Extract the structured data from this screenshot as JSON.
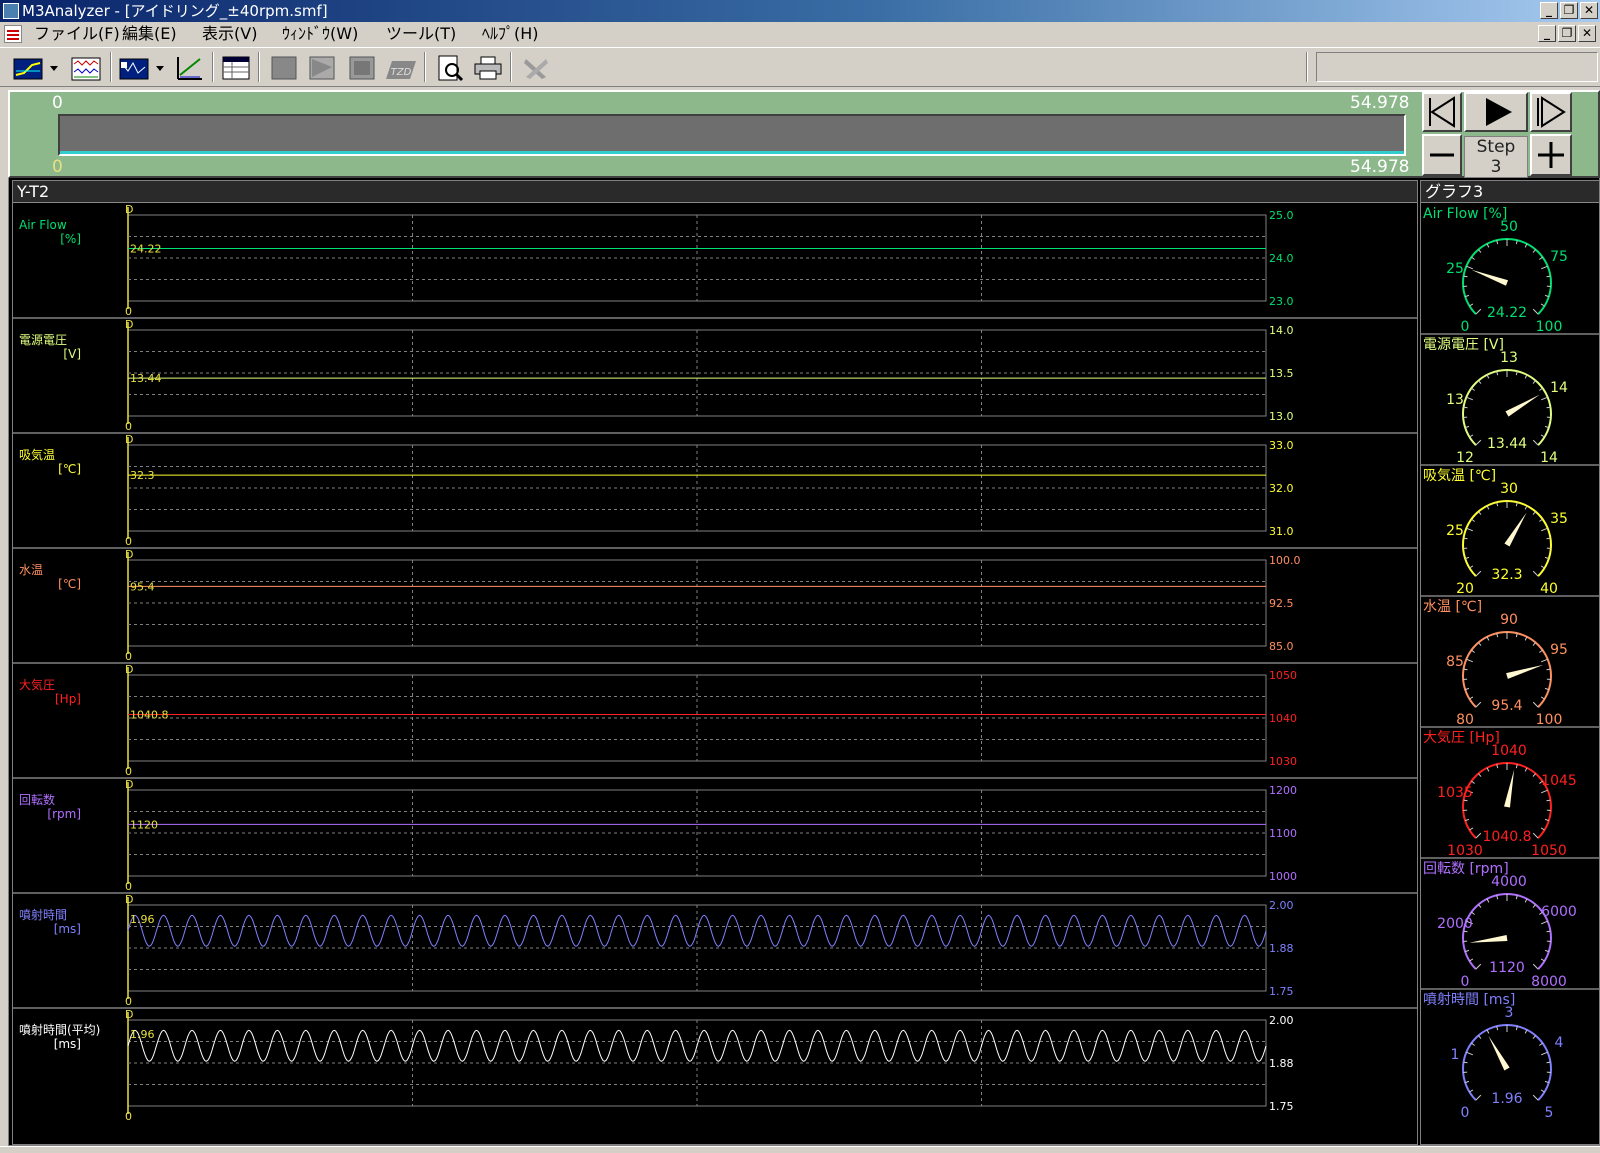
{
  "window": {
    "title": "M3Analyzer - [アイドリング_±40rpm.smf]"
  },
  "menu": [
    "ファイル(F)",
    "編集(E)",
    "表示(V)",
    "ｳｨﾝﾄﾞｳ(W)",
    "ツール(T)",
    "ﾍﾙﾌﾟ(H)"
  ],
  "toolbar": [
    "yt-graph-icon",
    "dropdown-arrow-icon",
    "waveform-list-icon",
    "signal-select-icon",
    "dropdown-arrow-icon",
    "ruler-measure-icon",
    "data-table-icon",
    "block-solid-icon",
    "block-triangle-icon",
    "block-frame-icon",
    "tzd-icon",
    "print-preview-icon",
    "print-icon",
    "disabled-tool-icon"
  ],
  "timeline": {
    "start_top": "0",
    "end_top": "54.978",
    "start_bottom": "0",
    "end_bottom": "54.978",
    "step_label": "Step",
    "step_value": "3"
  },
  "yt_panel": {
    "title": "Y-T2"
  },
  "gauge_panel": {
    "title": "グラフ3"
  },
  "channels": [
    {
      "name": "Air Flow",
      "unit": "[%]",
      "color": "#00e070",
      "value": "24.22",
      "ymax_label": "25.0",
      "ymid_label": "24.0",
      "ymin_label": "23.0",
      "ymin": 23.0,
      "ymax": 25.0,
      "level": 24.22,
      "wave": false,
      "gauge": {
        "title": "Air Flow [%]",
        "min": 0,
        "max": 100,
        "value": 24.22,
        "value_label": "24.22",
        "ticks": [
          "0",
          "25",
          "50",
          "75",
          "100"
        ]
      }
    },
    {
      "name": "電源電圧",
      "unit": "[V]",
      "color": "#e0ff80",
      "value": "13.44",
      "ymax_label": "14.0",
      "ymid_label": "13.5",
      "ymin_label": "13.0",
      "ymin": 13.0,
      "ymax": 14.0,
      "level": 13.44,
      "wave": false,
      "gauge": {
        "title": "電源電圧 [V]",
        "min": 12,
        "max": 14,
        "value": 13.44,
        "value_label": "13.44",
        "ticks": [
          "12",
          "13",
          "13",
          "14",
          "14"
        ]
      }
    },
    {
      "name": "吸気温",
      "unit": "[℃]",
      "color": "#ffff30",
      "value": "32.3",
      "ymax_label": "33.0",
      "ymid_label": "32.0",
      "ymin_label": "31.0",
      "ymin": 31.0,
      "ymax": 33.0,
      "level": 32.3,
      "wave": false,
      "gauge": {
        "title": "吸気温 [℃]",
        "min": 20,
        "max": 40,
        "value": 32.3,
        "value_label": "32.3",
        "ticks": [
          "20",
          "25",
          "30",
          "35",
          "40"
        ]
      }
    },
    {
      "name": "水温",
      "unit": "[℃]",
      "color": "#ff9060",
      "value": "95.4",
      "ymax_label": "100.0",
      "ymid_label": "92.5",
      "ymin_label": "85.0",
      "ymin": 85.0,
      "ymax": 100.0,
      "level": 95.4,
      "wave": false,
      "gauge": {
        "title": "水温 [℃]",
        "min": 80,
        "max": 100,
        "value": 95.4,
        "value_label": "95.4",
        "ticks": [
          "80",
          "85",
          "90",
          "95",
          "100"
        ]
      }
    },
    {
      "name": "大気圧",
      "unit": "[Hp]",
      "color": "#ff2020",
      "value": "1040.8",
      "ymax_label": "1050",
      "ymid_label": "1040",
      "ymin_label": "1030",
      "ymin": 1030,
      "ymax": 1050,
      "level": 1040.8,
      "wave": false,
      "gauge": {
        "title": "大気圧 [Hp]",
        "min": 1030,
        "max": 1050,
        "value": 1040.8,
        "value_label": "1040.8",
        "ticks": [
          "1030",
          "1035",
          "1040",
          "1045",
          "1050"
        ]
      }
    },
    {
      "name": "回転数",
      "unit": "[rpm]",
      "color": "#b070ff",
      "value": "1120",
      "ymax_label": "1200",
      "ymid_label": "1100",
      "ymin_label": "1000",
      "ymin": 1000,
      "ymax": 1200,
      "level": 1120,
      "wave": false,
      "gauge": {
        "title": "回転数 [rpm]",
        "min": 0,
        "max": 8000,
        "value": 1120,
        "value_label": "1120",
        "ticks": [
          "0",
          "2000",
          "4000",
          "6000",
          "8000"
        ]
      }
    },
    {
      "name": "噴射時間",
      "unit": "[ms]",
      "color": "#8080ff",
      "value": "1.96",
      "ymax_label": "2.00",
      "ymid_label": "1.88",
      "ymin_label": "1.75",
      "ymin": 1.75,
      "ymax": 2.0,
      "level": 1.96,
      "wave": true,
      "gauge": {
        "title": "噴射時間 [ms]",
        "min": 0,
        "max": 5,
        "value": 1.96,
        "value_label": "1.96",
        "ticks": [
          "0",
          "1",
          "3",
          "4",
          "5"
        ]
      }
    },
    {
      "name": "噴射時間(平均)",
      "unit": "[ms]",
      "color": "#ffffff",
      "value": "1.96",
      "ymax_label": "2.00",
      "ymid_label": "1.88",
      "ymin_label": "1.75",
      "ymin": 1.75,
      "ymax": 2.0,
      "level": 1.96,
      "wave": true,
      "gauge": null
    }
  ],
  "axis_marker_top": "D",
  "axis_marker_bottom": "0"
}
